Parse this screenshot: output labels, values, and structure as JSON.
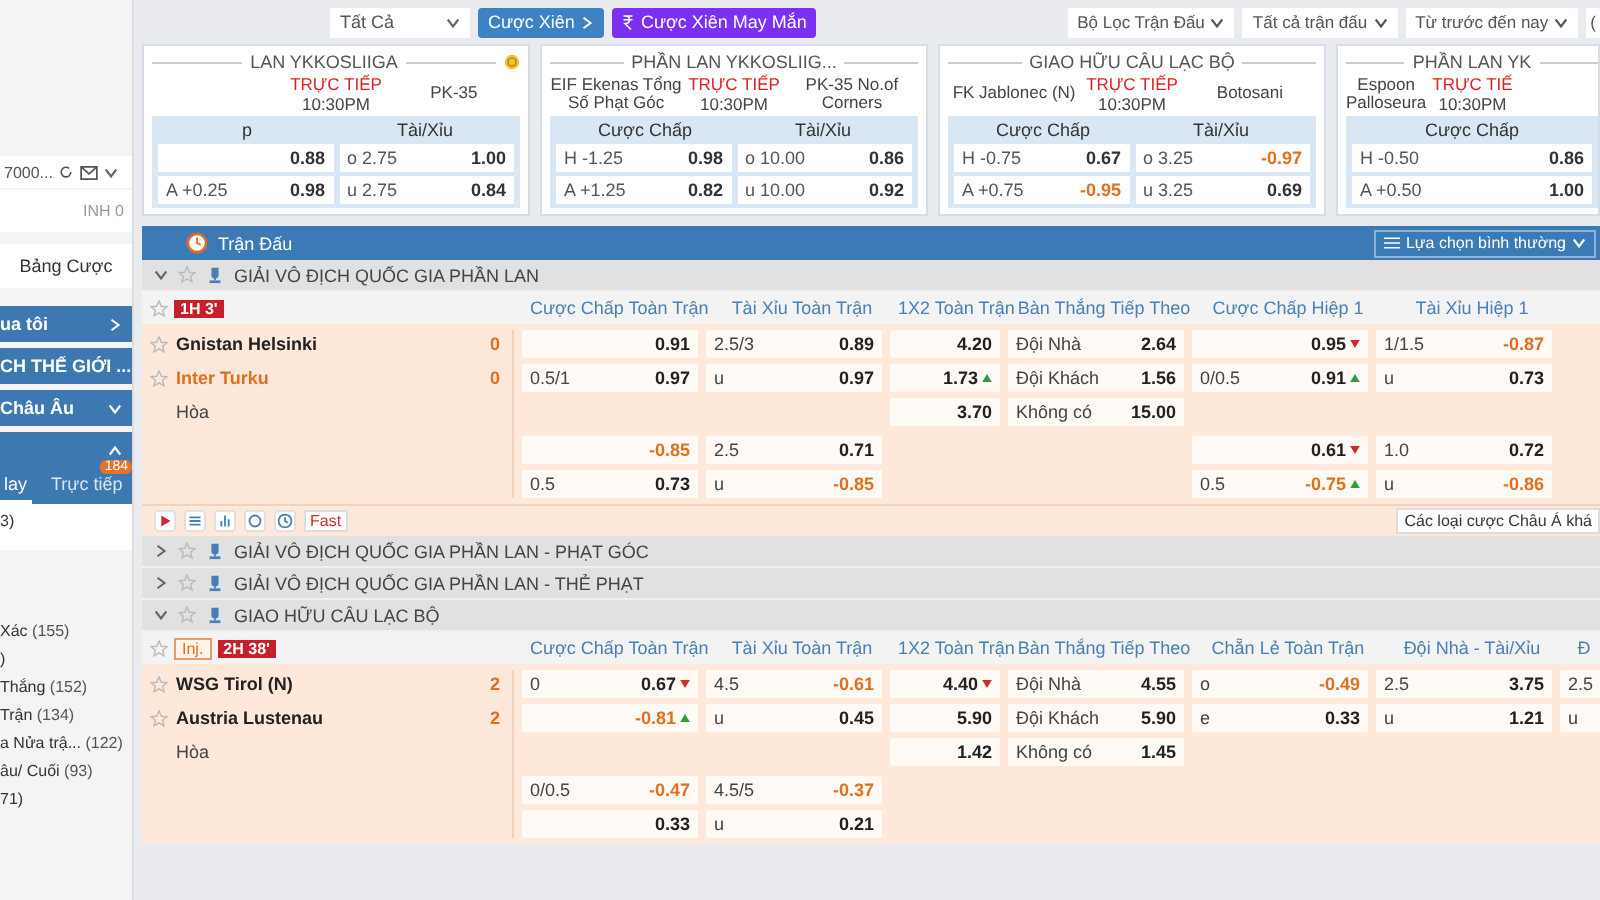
{
  "top_bar": {
    "filter": "Tất Cả",
    "parlay_button": "Cược Xiên",
    "lucky_parlay_button": "Cược Xiên May Mắn",
    "right_filters": [
      "Bộ Lọc Trận Đấu",
      "Tất cả trận đấu",
      "Từ trước đến nay"
    ],
    "cut_filter": "("
  },
  "sidebar": {
    "account": "7000...",
    "balance": "INH 0",
    "bet_slip": "Bảng Cược",
    "menus": [
      {
        "label": "ua tôi",
        "kind": "link",
        "expanded": false
      },
      {
        "label": "CH THẾ GIỚI ...",
        "kind": "group",
        "expanded": false
      },
      {
        "label": "Châu Âu",
        "kind": "group",
        "expanded": false
      },
      {
        "kind": "group",
        "expanded": true
      }
    ],
    "tabs": [
      {
        "label": "lay",
        "selected": true
      },
      {
        "label": "Trực tiếp",
        "selected": false,
        "badge": "184"
      }
    ],
    "panel_items": [
      "3)"
    ],
    "items": [
      {
        "label": "Xác",
        "count": "(155)"
      },
      {
        "label": ")"
      },
      {
        "label": "Thắng",
        "count": "(152)"
      },
      {
        "label": "Trận",
        "count": "(134)"
      },
      {
        "label": "a Nửa trậ...",
        "count": "(122)"
      },
      {
        "label": "âu/ Cuối",
        "count": "(93)"
      },
      {
        "label": "71)"
      }
    ]
  },
  "cards": [
    {
      "league": "LAN YKKOSLIIGA",
      "status": "TRỰC TIẾP",
      "time": "10:30PM",
      "away": "PK-35",
      "headers": [
        "p",
        "Tài/Xỉu"
      ],
      "rows": [
        [
          {
            "odds": "0.88"
          },
          {
            "line": "o 2.75",
            "odds": "1.00"
          }
        ],
        [
          {
            "line": "A +0.25",
            "odds": "0.98"
          },
          {
            "line": "u 2.75",
            "odds": "0.84"
          }
        ]
      ]
    },
    {
      "league": "PHẦN LAN YKKOSLIIG...",
      "home": "EIF Ekenas Tổng Số Phạt Góc",
      "status": "TRỰC TIẾP",
      "time": "10:30PM",
      "away": "PK-35 No.of Corners",
      "headers": [
        "Cược Chấp",
        "Tài/Xỉu"
      ],
      "rows": [
        [
          {
            "line": "H -1.25",
            "odds": "0.98"
          },
          {
            "line": "o 10.00",
            "odds": "0.86"
          }
        ],
        [
          {
            "line": "A +1.25",
            "odds": "0.82"
          },
          {
            "line": "u 10.00",
            "odds": "0.92"
          }
        ]
      ]
    },
    {
      "league": "GIAO HỮU CÂU LẠC BỘ",
      "home": "FK Jablonec (N)",
      "status": "TRỰC TIẾP",
      "time": "10:30PM",
      "away": "Botosani",
      "headers": [
        "Cược Chấp",
        "Tài/Xỉu"
      ],
      "rows": [
        [
          {
            "line": "H -0.75",
            "odds": "0.67"
          },
          {
            "line": "o 3.25",
            "odds": "-0.97"
          }
        ],
        [
          {
            "line": "A +0.75",
            "odds": "-0.95"
          },
          {
            "line": "u 3.25",
            "odds": "0.69"
          }
        ]
      ]
    },
    {
      "league": "PHẦN LAN YK",
      "home": "Espoon Palloseura",
      "status": "TRỰC TIẾ",
      "time": "10:30PM",
      "headers": [
        "Cược Chấp"
      ],
      "rows": [
        [
          {
            "line": "H -0.50",
            "odds": "0.86"
          }
        ],
        [
          {
            "line": "A +0.50",
            "odds": "1.00"
          }
        ]
      ]
    }
  ],
  "matches_bar": {
    "title": "Trận Đấu",
    "view": "Lựa chọn bình thường"
  },
  "leagues": [
    {
      "name": "GIẢI VÔ ĐỊCH QUỐC GIA PHẦN LAN",
      "expanded": true,
      "status": [
        {
          "text": "1H 3'",
          "kind": "live"
        }
      ],
      "columns": [
        {
          "label": "Cược Chấp Toàn Trận",
          "kind": "pair"
        },
        {
          "label": "Tài Xỉu Toàn Trận",
          "kind": "pair"
        },
        {
          "label": "1X2 Toàn Trận",
          "kind": "single"
        },
        {
          "label": "Bàn Thắng Tiếp Theo",
          "kind": "pair"
        },
        {
          "label": "Cược Chấp Hiệp 1",
          "kind": "pair"
        },
        {
          "label": "Tài Xỉu Hiệp 1",
          "kind": "pair"
        }
      ],
      "teams": [
        {
          "name": "Gnistan Helsinki",
          "score": "0",
          "highlight": false
        },
        {
          "name": "Inter Turku",
          "score": "0",
          "highlight": true
        }
      ],
      "draw": "Hòa",
      "blocks": [
        [
          {
            "column_1": {
              "odds": "0.91"
            },
            "column_2": {
              "line": "2.5/3",
              "odds": "0.89"
            },
            "column_3": {
              "odds": "4.20"
            },
            "column_4": {
              "line": "Đội Nhà",
              "odds": "2.64"
            },
            "column_5": {
              "odds": "0.95",
              "kind": "falling"
            },
            "column_6": {
              "line": "1/1.5",
              "odds": "-0.87"
            }
          },
          {
            "column_1": {
              "line": "0.5/1",
              "odds": "0.97"
            },
            "column_2": {
              "line": "u",
              "odds": "0.97"
            },
            "column_3": {
              "odds": "1.73",
              "kind": "rising"
            },
            "column_4": {
              "line": "Đội Khách",
              "odds": "1.56"
            },
            "column_5": {
              "line": "0/0.5",
              "odds": "0.91",
              "kind": "rising"
            },
            "column_6": {
              "line": "u",
              "odds": "0.73"
            }
          },
          {
            "column_3": {
              "odds": "3.70"
            },
            "column_4": {
              "line": "Không có",
              "odds": "15.00"
            }
          }
        ],
        [
          {
            "column_1": {
              "odds": "-0.85"
            },
            "column_2": {
              "line": "2.5",
              "odds": "0.71"
            },
            "column_5": {
              "odds": "0.61",
              "kind": "falling"
            },
            "column_6": {
              "line": "1.0",
              "odds": "0.72"
            }
          },
          {
            "column_1": {
              "line": "0.5",
              "odds": "0.73"
            },
            "column_2": {
              "line": "u",
              "odds": "-0.85"
            },
            "column_5": {
              "line": "0.5",
              "odds": "-0.75",
              "kind": "rising"
            },
            "column_6": {
              "line": "u",
              "odds": "-0.86"
            }
          }
        ]
      ],
      "footer": {
        "fast": "Fast",
        "more": "Các loại cược Châu Á khá"
      }
    },
    {
      "name": "GIẢI VÔ ĐỊCH QUỐC GIA PHẦN LAN - PHẠT GÓC",
      "expanded": false
    },
    {
      "name": "GIẢI VÔ ĐỊCH QUỐC GIA PHẦN LAN - THẺ PHẠT",
      "expanded": false
    },
    {
      "name": "GIAO HỮU CÂU LẠC BỘ",
      "expanded": true,
      "status": [
        {
          "text": "Inj.",
          "kind": "injury"
        },
        {
          "text": "2H 38'",
          "kind": "live"
        }
      ],
      "columns": [
        {
          "label": "Cược Chấp Toàn Trận",
          "kind": "pair"
        },
        {
          "label": "Tài Xỉu Toàn Trận",
          "kind": "pair"
        },
        {
          "label": "1X2 Toàn Trận",
          "kind": "single"
        },
        {
          "label": "Bàn Thắng Tiếp Theo",
          "kind": "pair"
        },
        {
          "label": "Chẵn Lẻ Toàn Trận",
          "kind": "pair"
        },
        {
          "label": "Đội Nhà - Tài/Xỉu",
          "kind": "pair"
        },
        {
          "label": "Đ",
          "kind": "cut"
        }
      ],
      "teams": [
        {
          "name": "WSG Tirol (N)",
          "score": "2",
          "highlight": false
        },
        {
          "name": "Austria Lustenau",
          "score": "2",
          "highlight": false
        }
      ],
      "draw": "Hòa",
      "blocks": [
        [
          {
            "column_1": {
              "line": "0",
              "odds": "0.67",
              "kind": "falling"
            },
            "column_2": {
              "line": "4.5",
              "odds": "-0.61"
            },
            "column_3": {
              "odds": "4.40",
              "kind": "falling"
            },
            "column_4": {
              "line": "Đội Nhà",
              "odds": "4.55"
            },
            "column_5": {
              "line": "o",
              "odds": "-0.49"
            },
            "column_6": {
              "line": "2.5",
              "odds": "3.75"
            },
            "column_7": {
              "line": "2.5"
            }
          },
          {
            "column_1": {
              "odds": "-0.81",
              "kind": "rising"
            },
            "column_2": {
              "line": "u",
              "odds": "0.45"
            },
            "column_3": {
              "odds": "5.90"
            },
            "column_4": {
              "line": "Đội Khách",
              "odds": "5.90"
            },
            "column_5": {
              "line": "e",
              "odds": "0.33"
            },
            "column_6": {
              "line": "u",
              "odds": "1.21"
            },
            "column_7": {
              "line": "u"
            }
          },
          {
            "column_3": {
              "odds": "1.42"
            },
            "column_4": {
              "line": "Không có",
              "odds": "1.45"
            }
          }
        ],
        [
          {
            "column_1": {
              "line": "0/0.5",
              "odds": "-0.47"
            },
            "column_2": {
              "line": "4.5/5",
              "odds": "-0.37"
            }
          },
          {
            "column_1": {
              "odds": "0.33"
            },
            "column_2": {
              "line": "u",
              "odds": "0.21"
            }
          }
        ]
      ]
    }
  ]
}
